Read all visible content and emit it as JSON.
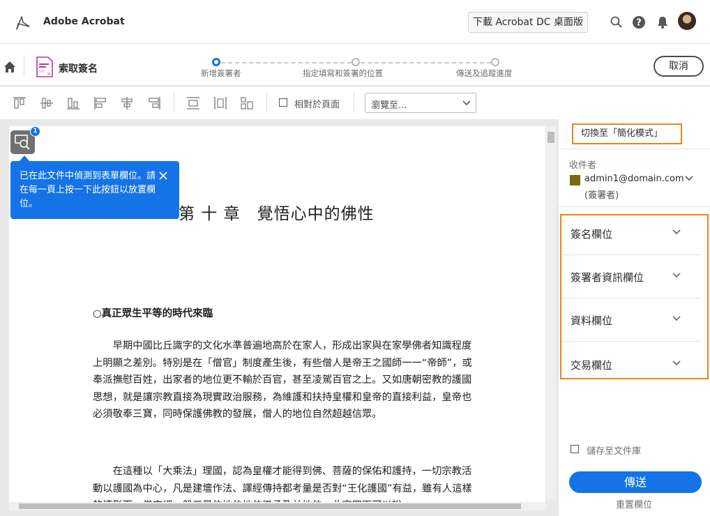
{
  "app": {
    "brand_name": "Adobe Acrobat",
    "download_button": "下載 Acrobat DC 桌面版",
    "icons": [
      "search-icon",
      "help-icon",
      "bell-icon",
      "avatar"
    ]
  },
  "workflow": {
    "title": "索取簽名",
    "steps": [
      {
        "label": "新增簽署者",
        "active": true
      },
      {
        "label": "指定填寫和簽署的位置",
        "active": false
      },
      {
        "label": "傳送及追蹤進度",
        "active": false
      }
    ],
    "cancel_button": "取消"
  },
  "toolbar": {
    "icons": [
      "align-top-icon",
      "align-middle-icon",
      "align-bottom-icon",
      "align-left-icon",
      "align-center-icon",
      "align-right-icon",
      "distribute-vertical-icon",
      "distribute-horizontal-icon",
      "match-size-icon"
    ],
    "relative_label": "相對於頁面",
    "relative_checked": false,
    "browse_value": "瀏覽至..."
  },
  "document": {
    "detect_badge_count": "1",
    "tooltip_text": "已在此文件中偵測到表單欄位。請在每一頁上按一下此按鈕以放置欄位。",
    "chapter_title": "第 十 章　覺悟心中的佛性",
    "section_heading": "○真正眾生平等的時代來臨",
    "paragraph_1": "　　早期中國比丘識字的文化水準普遍地高於在家人，形成出家與在家學佛者知識程度上明顯之差別。特別是在「僧官」制度產生後，有些僧人是帝王之國師一一“帝師”，或奉派撫慰百姓，出家者的地位更不輸於百官，甚至凌駕百官之上。又如唐朝密教的護國思想，就是讓宗教直接為現實政治服務，為維護和扶持皇權和皇帝的直接利益，皇帝也必須敬奉三寶，同時保護佛教的發展，僧人的地位自然超越信眾。",
    "paragraph_2": "　　在這種以「大乘法」理國，認為皇權才能得到佛、菩薩的保佑和護持，一切宗教活動以護國為中心，凡是建壇作法、譯經傳持都考量是否對“王化護國”有益，雖有人這樣的情形下，僧來卻一般三是依地位地位繼承及並地位。此宗四面可以說，"
  },
  "panel": {
    "mode_switch": "切換至「簡化模式」",
    "recipients_label": "收件者",
    "recipient_email": "admin1@domain.com",
    "recipient_role": "(簽署者)",
    "recipient_color": "#7a6a0c",
    "fields": [
      "簽名欄位",
      "簽署者資訊欄位",
      "資料欄位",
      "交易欄位"
    ],
    "save_label": "儲存至文件庫",
    "save_checked": false,
    "send_button": "傳送",
    "reset_link": "重置欄位",
    "accent": "#1473e6",
    "highlight": "#e68619"
  }
}
